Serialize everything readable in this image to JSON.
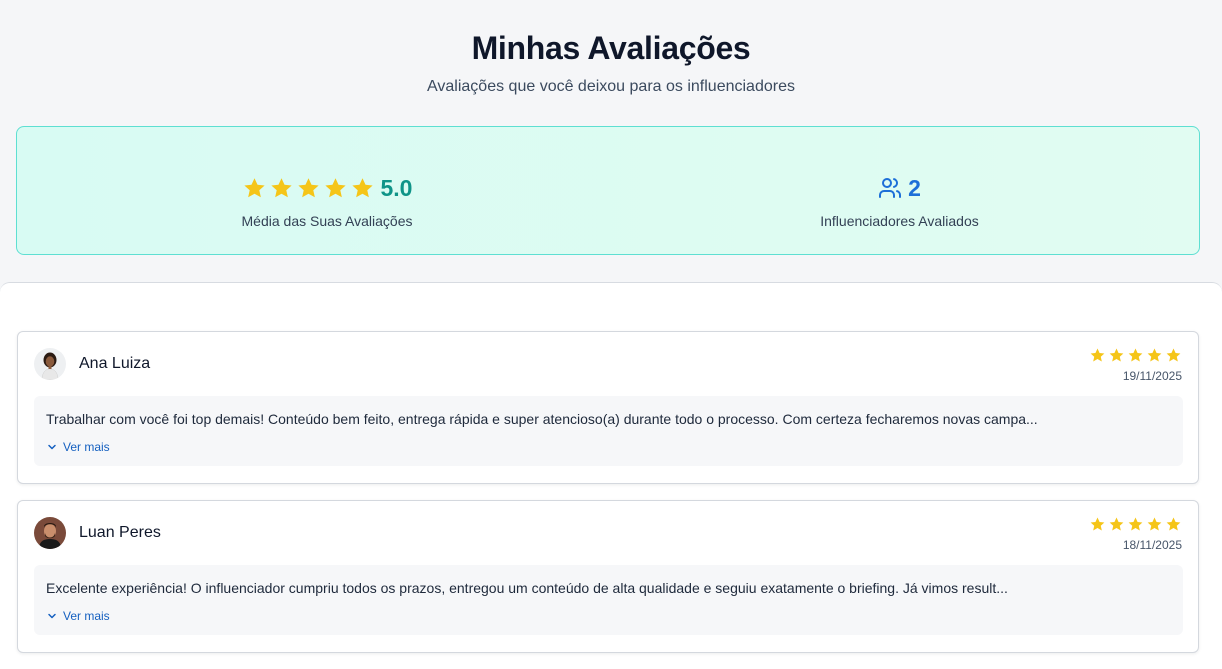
{
  "header": {
    "title": "Minhas Avaliações",
    "subtitle": "Avaliações que você deixou para os influenciadores"
  },
  "stats": {
    "average_rating": {
      "value": "5.0",
      "stars": 5,
      "label": "Média das Suas Avaliações",
      "icon": "star-icon"
    },
    "influencers_rated": {
      "value": "2",
      "label": "Influenciadores Avaliados",
      "icon": "users-icon"
    }
  },
  "reviews": [
    {
      "name": "Ana Luiza",
      "rating": 5,
      "date": "19/11/2025",
      "text": "Trabalhar com você foi top demais! Conteúdo bem feito, entrega rápida e super atencioso(a) durante todo o processo. Com certeza fecharemos novas campa...",
      "see_more": "Ver mais"
    },
    {
      "name": "Luan Peres",
      "rating": 5,
      "date": "18/11/2025",
      "text": "Excelente experiência! O influenciador cumpriu todos os prazos, entregou um conteúdo de alta qualidade e seguiu exatamente o briefing. Já vimos result...",
      "see_more": "Ver mais"
    }
  ],
  "colors": {
    "star": "#f5c518",
    "accent_teal": "#0f9488",
    "accent_blue": "#1d6fd8",
    "link_blue": "#1560c0",
    "stats_border": "#5edfd2"
  }
}
